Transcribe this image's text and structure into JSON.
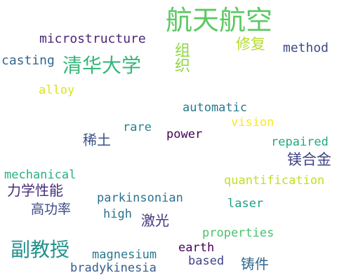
{
  "words": [
    {
      "id": "hangtian-hangkong",
      "text": "航天航空",
      "color": "#5cc863"
    },
    {
      "id": "microstructure",
      "text": "microstructure",
      "color": "#482878"
    },
    {
      "id": "xiufu",
      "text": "修复",
      "color": "#b5de2b"
    },
    {
      "id": "method",
      "text": "method",
      "color": "#3e4989"
    },
    {
      "id": "casting",
      "text": "casting",
      "color": "#31688e"
    },
    {
      "id": "qinghua-daxue",
      "text": "清华大学",
      "color": "#35b779"
    },
    {
      "id": "zuzhi",
      "text": "组织",
      "color": "#8fd744"
    },
    {
      "id": "alloy",
      "text": "alloy",
      "color": "#dde318"
    },
    {
      "id": "automatic",
      "text": "automatic",
      "color": "#2a788e"
    },
    {
      "id": "rare",
      "text": "rare",
      "color": "#26828e"
    },
    {
      "id": "vision",
      "text": "vision",
      "color": "#fde725"
    },
    {
      "id": "xitu",
      "text": "稀土",
      "color": "#3b528b"
    },
    {
      "id": "power",
      "text": "power",
      "color": "#440154"
    },
    {
      "id": "repaired",
      "text": "repaired",
      "color": "#22a884"
    },
    {
      "id": "meihejin",
      "text": "镁合金",
      "color": "#414487"
    },
    {
      "id": "mechanical",
      "text": "mechanical",
      "color": "#29af7f"
    },
    {
      "id": "quantification",
      "text": "quantification",
      "color": "#c2df23"
    },
    {
      "id": "lixue-xingneng",
      "text": "力学性能",
      "color": "#472d7b"
    },
    {
      "id": "parkinsonian",
      "text": "parkinsonian",
      "color": "#2c728e"
    },
    {
      "id": "gaogonglv",
      "text": "高功率",
      "color": "#3e4a89"
    },
    {
      "id": "laser",
      "text": "laser",
      "color": "#1fa187"
    },
    {
      "id": "high",
      "text": "high",
      "color": "#2c728e"
    },
    {
      "id": "jiguang",
      "text": "激光",
      "color": "#46337e"
    },
    {
      "id": "properties",
      "text": "properties",
      "color": "#4ac16d"
    },
    {
      "id": "fujiaoshou",
      "text": "副教授",
      "color": "#21918c"
    },
    {
      "id": "earth",
      "text": "earth",
      "color": "#440154"
    },
    {
      "id": "magnesium",
      "text": "magnesium",
      "color": "#2a788e"
    },
    {
      "id": "based",
      "text": "based",
      "color": "#404387"
    },
    {
      "id": "zhujian",
      "text": "铸件",
      "color": "#31688e"
    },
    {
      "id": "bradykinesia",
      "text": "bradykinesia",
      "color": "#365c8d"
    }
  ]
}
